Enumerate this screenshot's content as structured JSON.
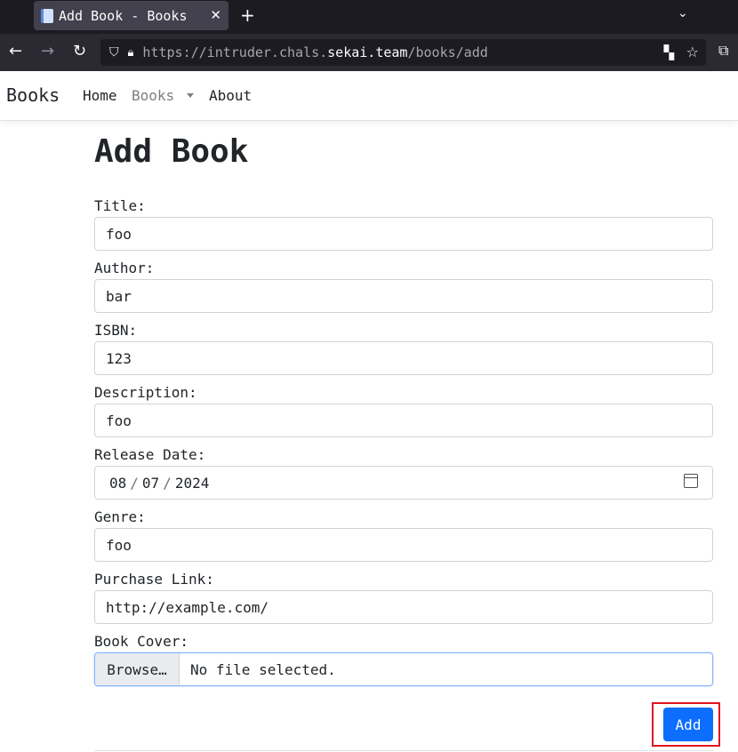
{
  "browser": {
    "tab_title": "Add Book - Books",
    "new_tab": "+",
    "url_scheme": "https://intruder.chals.",
    "url_host": "sekai.team",
    "url_path": "/books/add"
  },
  "site_nav": {
    "brand": "Books",
    "home": "Home",
    "books": "Books",
    "about": "About"
  },
  "page": {
    "title": "Add Book"
  },
  "form": {
    "title_label": "Title:",
    "title_value": "foo",
    "author_label": "Author:",
    "author_value": "bar",
    "isbn_label": "ISBN:",
    "isbn_value": "123",
    "description_label": "Description:",
    "description_value": "foo",
    "release_label": "Release Date:",
    "release_month": "08",
    "release_day": "07",
    "release_year": "2024",
    "release_sep": "/",
    "genre_label": "Genre:",
    "genre_value": "foo",
    "purchase_label": "Purchase Link:",
    "purchase_value": "http://example.com/",
    "cover_label": "Book Cover:",
    "browse_label": "Browse…",
    "file_status": "No file selected.",
    "submit_label": "Add"
  },
  "colors": {
    "accent": "#0d6efd",
    "highlight": "#e0141e",
    "chrome_dark": "#1c1b22"
  }
}
